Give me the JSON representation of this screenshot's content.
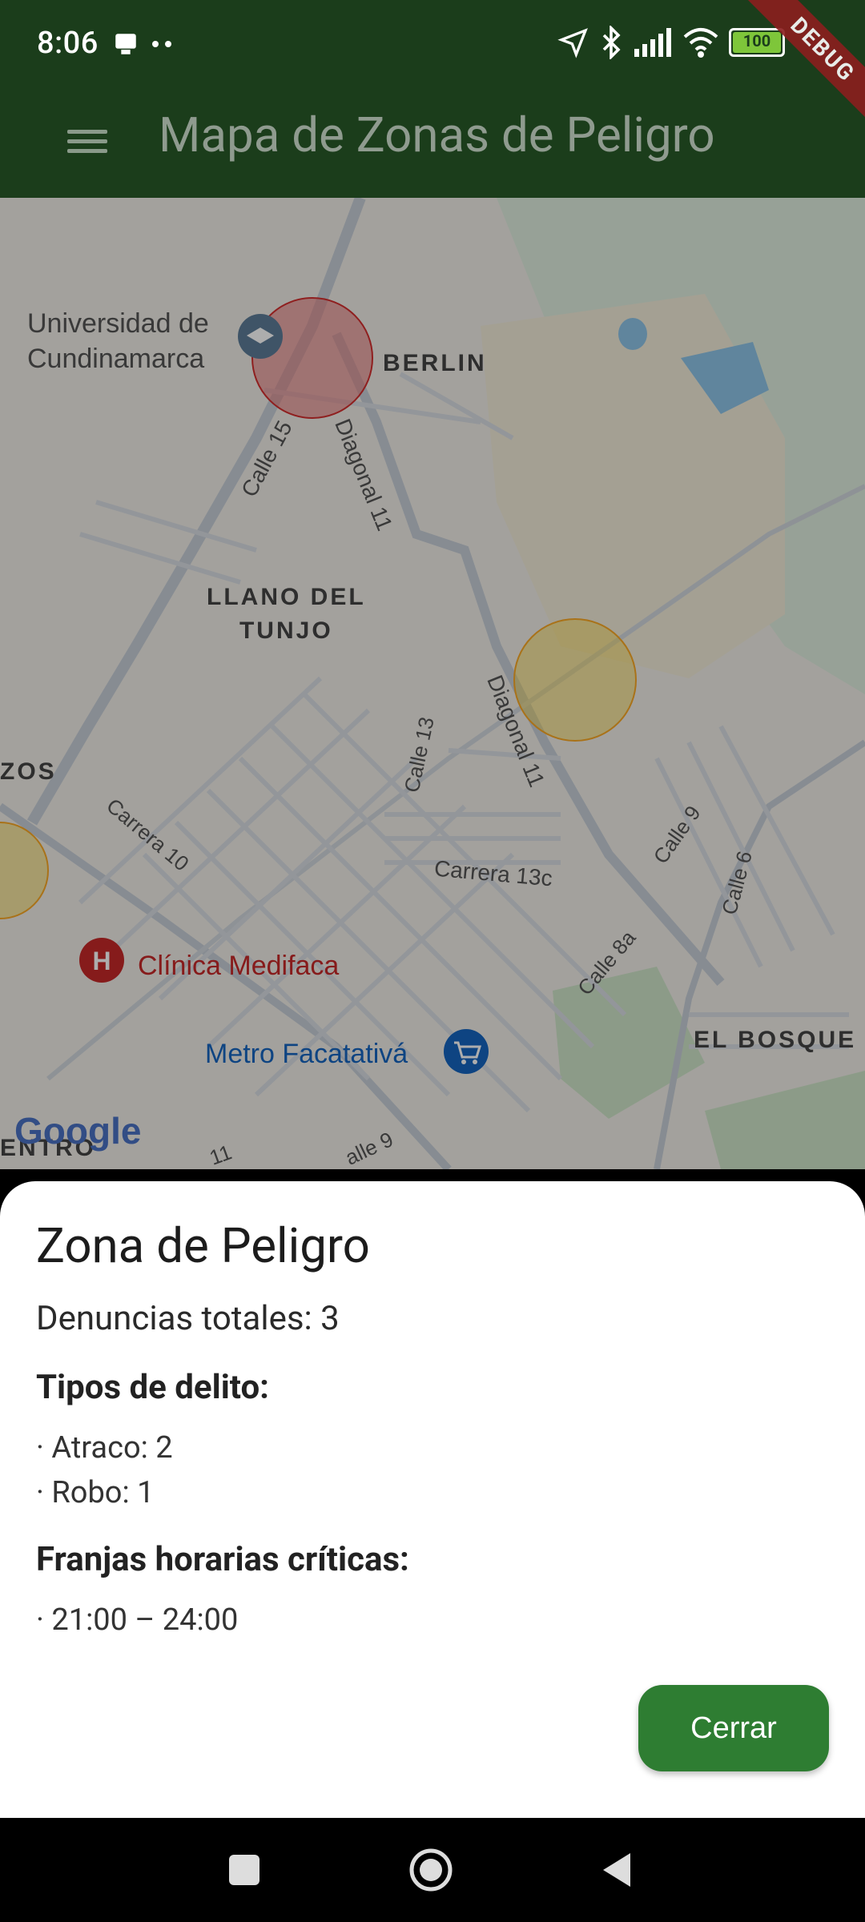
{
  "status_bar": {
    "time": "8:06",
    "battery": "100",
    "icons": [
      "notification-icon",
      "location-arrow-icon",
      "bluetooth-icon",
      "signal-icon",
      "wifi-icon",
      "battery-icon"
    ]
  },
  "debug_banner": "DEBUG",
  "app_bar": {
    "title": "Mapa de Zonas de Peligro",
    "menu_icon": "hamburger-menu-icon"
  },
  "map": {
    "labels": {
      "universidad_1": "Universidad de",
      "universidad_2": "Cundinamarca",
      "berlin": "BERLIN",
      "calle15": "Calle 15",
      "diagonal11_a": "Diagonal 11",
      "diagonal11_b": "Diagonal 11",
      "llano_1": "LLANO DEL",
      "llano_2": "TUNJO",
      "zos": "ZOS",
      "calle13": "Calle 13",
      "carrera10": "Carrera 10",
      "carrera13c": "Carrera 13c",
      "calle9": "Calle 9",
      "calle6": "Calle 6",
      "calle8a": "Calle 8a",
      "clinica": "Clínica Medifaca",
      "metro": "Metro Facatativá",
      "el_bosque": "EL BOSQUE",
      "centro": "ENTRO",
      "num11": "11",
      "calle9b": "alle 9",
      "google": "Google"
    },
    "zones": [
      {
        "color": "#e57373",
        "level": "high"
      },
      {
        "color": "#fdd835",
        "level": "medium"
      },
      {
        "color": "#fdd835",
        "level": "medium"
      }
    ]
  },
  "sheet": {
    "title": "Zona de Peligro",
    "total": "Denuncias totales: 3",
    "types_heading": "Tipos de delito:",
    "types": [
      "· Atraco: 2",
      "· Robo: 1"
    ],
    "hours_heading": "Franjas horarias críticas:",
    "hours": [
      "· 21:00 – 24:00"
    ],
    "close_label": "Cerrar"
  },
  "colors": {
    "app_bar": "#1b3d1b",
    "accent_button": "#2e7d32"
  }
}
